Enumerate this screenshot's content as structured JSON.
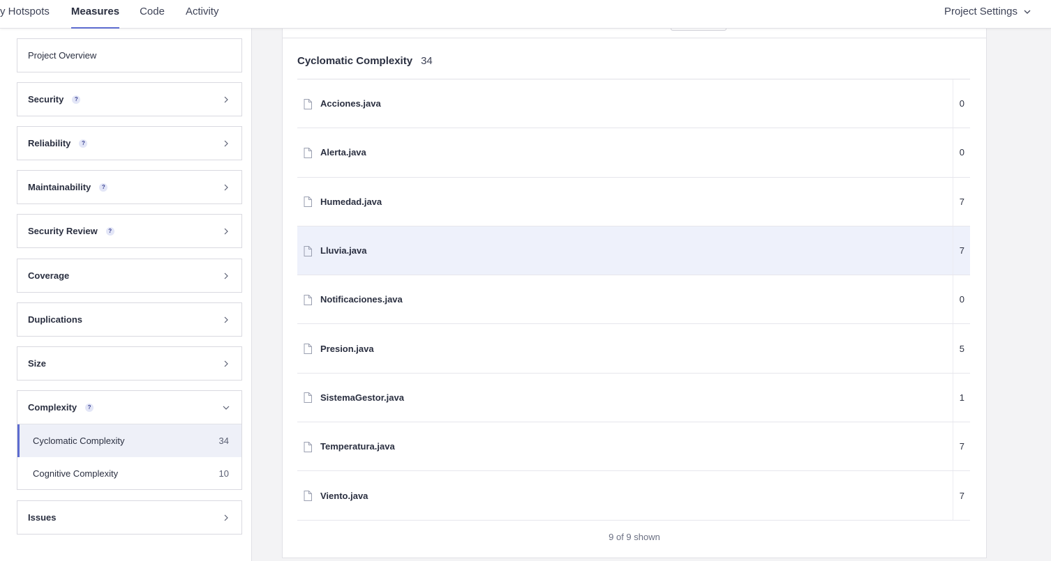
{
  "nav": {
    "tabs": [
      {
        "label": "y Hotspots"
      },
      {
        "label": "Measures"
      },
      {
        "label": "Code"
      },
      {
        "label": "Activity"
      }
    ],
    "settings_label": "Project Settings"
  },
  "sidebar": {
    "overview": "Project Overview",
    "domains": [
      {
        "label": "Security",
        "help": "?"
      },
      {
        "label": "Reliability",
        "help": "?"
      },
      {
        "label": "Maintainability",
        "help": "?"
      },
      {
        "label": "Security Review",
        "help": "?"
      },
      {
        "label": "Coverage"
      },
      {
        "label": "Duplications"
      },
      {
        "label": "Size"
      }
    ],
    "complexity": {
      "label": "Complexity",
      "help": "?",
      "items": [
        {
          "label": "Cyclomatic Complexity",
          "value": "34"
        },
        {
          "label": "Cognitive Complexity",
          "value": "10"
        }
      ]
    },
    "issues": "Issues"
  },
  "main": {
    "metric_name": "Cyclomatic Complexity",
    "metric_value": "34",
    "files": [
      {
        "name": "Acciones.java",
        "value": "0"
      },
      {
        "name": "Alerta.java",
        "value": "0"
      },
      {
        "name": "Humedad.java",
        "value": "7"
      },
      {
        "name": "Lluvia.java",
        "value": "7"
      },
      {
        "name": "Notificaciones.java",
        "value": "0"
      },
      {
        "name": "Presion.java",
        "value": "5"
      },
      {
        "name": "SistemaGestor.java",
        "value": "1"
      },
      {
        "name": "Temperatura.java",
        "value": "7"
      },
      {
        "name": "Viento.java",
        "value": "7"
      }
    ],
    "shown_text": "9 of 9 shown"
  }
}
